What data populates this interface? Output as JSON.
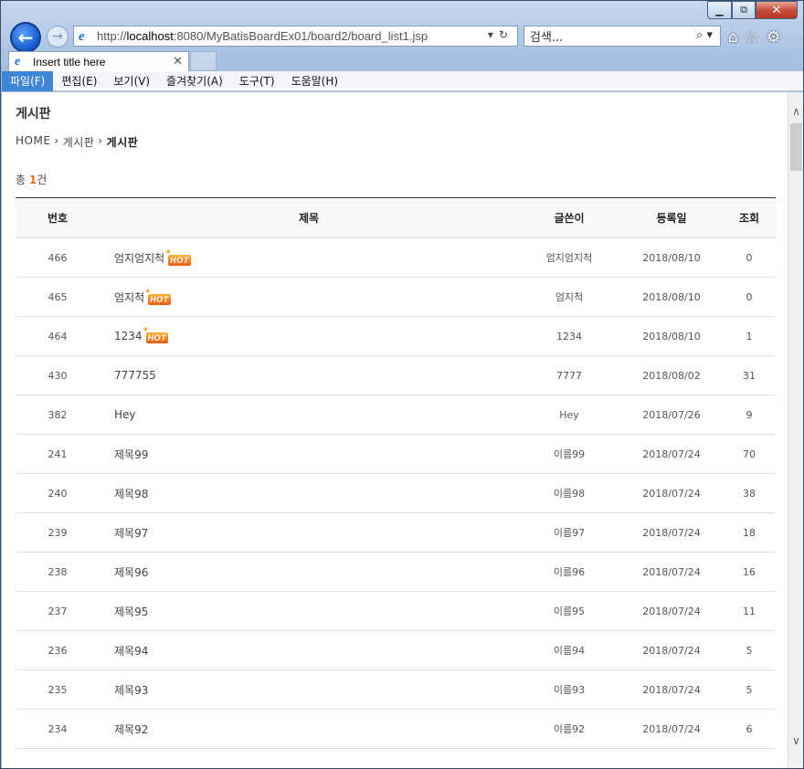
{
  "browser": {
    "address_prefix": "http://",
    "address_host": "localhost",
    "address_rest": ":8080/MyBatisBoardEx01/board2/board_list1.jsp",
    "search_placeholder": "검색...",
    "tab_title": "Insert title here",
    "menu": [
      "파일(F)",
      "편집(E)",
      "보기(V)",
      "즐겨찾기(A)",
      "도구(T)",
      "도움말(H)"
    ]
  },
  "page": {
    "title": "게시판",
    "breadcrumb": [
      "HOME",
      "게시판",
      "게시판"
    ],
    "count_prefix": "총 ",
    "count_value": "1",
    "count_suffix": "건"
  },
  "table": {
    "headers": [
      "번호",
      "제목",
      "글쓴이",
      "등록일",
      "조회"
    ],
    "hot_label": "HOT",
    "rows": [
      {
        "no": "466",
        "subject": "엄지엄지척",
        "writer": "엄지엄지척",
        "date": "2018/08/10",
        "hits": "0",
        "hot": true
      },
      {
        "no": "465",
        "subject": "엄지척",
        "writer": "엄지척",
        "date": "2018/08/10",
        "hits": "0",
        "hot": true
      },
      {
        "no": "464",
        "subject": "1234",
        "writer": "1234",
        "date": "2018/08/10",
        "hits": "1",
        "hot": true
      },
      {
        "no": "430",
        "subject": "777755",
        "writer": "7777",
        "date": "2018/08/02",
        "hits": "31",
        "hot": false
      },
      {
        "no": "382",
        "subject": "Hey",
        "writer": "Hey",
        "date": "2018/07/26",
        "hits": "9",
        "hot": false
      },
      {
        "no": "241",
        "subject": "제목99",
        "writer": "이름99",
        "date": "2018/07/24",
        "hits": "70",
        "hot": false
      },
      {
        "no": "240",
        "subject": "제목98",
        "writer": "이름98",
        "date": "2018/07/24",
        "hits": "38",
        "hot": false
      },
      {
        "no": "239",
        "subject": "제목97",
        "writer": "이름97",
        "date": "2018/07/24",
        "hits": "18",
        "hot": false
      },
      {
        "no": "238",
        "subject": "제목96",
        "writer": "이름96",
        "date": "2018/07/24",
        "hits": "16",
        "hot": false
      },
      {
        "no": "237",
        "subject": "제목95",
        "writer": "이름95",
        "date": "2018/07/24",
        "hits": "11",
        "hot": false
      },
      {
        "no": "236",
        "subject": "제목94",
        "writer": "이름94",
        "date": "2018/07/24",
        "hits": "5",
        "hot": false
      },
      {
        "no": "235",
        "subject": "제목93",
        "writer": "이름93",
        "date": "2018/07/24",
        "hits": "5",
        "hot": false
      },
      {
        "no": "234",
        "subject": "제목92",
        "writer": "이름92",
        "date": "2018/07/24",
        "hits": "6",
        "hot": false
      }
    ]
  }
}
